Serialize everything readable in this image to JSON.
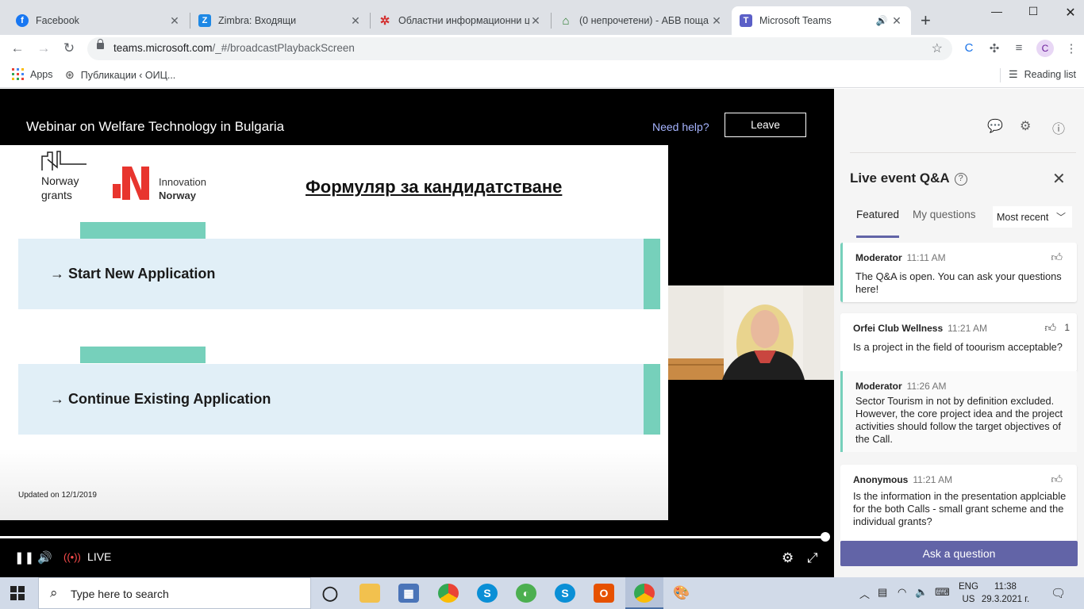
{
  "browser": {
    "tabs": [
      {
        "title": "Facebook"
      },
      {
        "title": "Zimbra: Входящи"
      },
      {
        "title": "Областни информационни ц"
      },
      {
        "title": "(0 непрочетени) - АБВ поща"
      },
      {
        "title": "Microsoft Teams"
      }
    ],
    "url_host": "teams.microsoft.com",
    "url_path": "/_#/broadcastPlaybackScreen",
    "profile_initial": "C",
    "bookmarks": {
      "apps": "Apps",
      "item1": "Публикации ‹ ОИЦ...",
      "reading_list": "Reading list"
    }
  },
  "event": {
    "title": "Webinar on Welfare Technology in Bulgaria",
    "need_help": "Need help?",
    "leave": "Leave"
  },
  "slide": {
    "norway_grants_line1": "Norway",
    "norway_grants_line2": "grants",
    "innovation_line1": "Innovation",
    "innovation_line2": "Norway",
    "heading": "Формуляр за кандидатстване",
    "option1": "→ Start New Application",
    "option2": "→ Continue Existing Application",
    "updated": "Updated on 12/1/2019",
    "colors": {
      "accent": "#76d0bb",
      "box": "#e1eff7",
      "logo_red": "#e8352e"
    }
  },
  "player": {
    "live": "LIVE"
  },
  "qa": {
    "title": "Live event Q&A",
    "tabs": [
      "Featured",
      "My questions"
    ],
    "sort": "Most recent",
    "ask": "Ask a question",
    "items": [
      {
        "author": "Moderator",
        "time": "11:11 AM",
        "text": "The Q&A is open. You can ask your questions here!",
        "likes": ""
      },
      {
        "author": "Orfei Club Wellness",
        "time": "11:21 AM",
        "text": "Is a project in the field of toourism acceptable?",
        "likes": "1"
      },
      {
        "author": "Moderator",
        "time": "11:26 AM",
        "text": "Sector Tourism in not by definition excluded. However, the core project idea and the project activities should follow the target objectives of the Call.",
        "likes": ""
      },
      {
        "author": "Anonymous",
        "time": "11:21 AM",
        "text": "Is the information in the presentation applciable for the both Calls - small grant scheme and the individual grants?",
        "likes": ""
      }
    ]
  },
  "taskbar": {
    "search_placeholder": "Type here to search",
    "lang1": "ENG",
    "lang2": "US",
    "time": "11:38",
    "date": "29.3.2021 г."
  }
}
